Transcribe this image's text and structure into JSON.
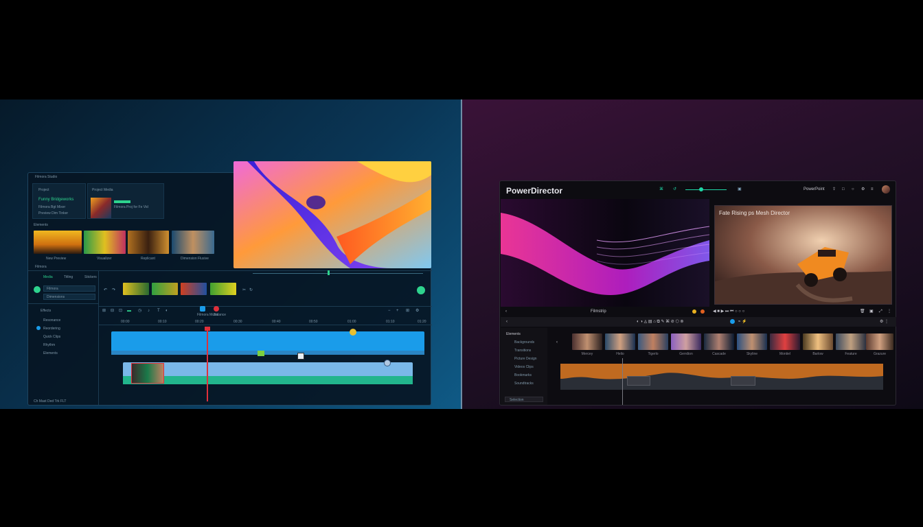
{
  "left_app": {
    "window_title": "Filmora Studio",
    "media_tabs": [
      "Project",
      "Project Media"
    ],
    "project_lines": [
      "Funny Bridgeworks",
      "Filmora Bgt Mixer",
      "Preview Dim Tinker"
    ],
    "thumb_caption": "Filmora Proj for Fe Vid",
    "section_label": "Elements",
    "thumb_labels": [
      "New Preview",
      "Visualizer",
      "Replicant",
      "Dimension Flusive"
    ],
    "panel_label": "Filmora",
    "mode_tabs": [
      "Media",
      "Titling",
      "Stickers"
    ],
    "props": [
      "Filmora",
      "Dimensions"
    ],
    "nav_items": [
      "Effects",
      "Resonance",
      "Reordering",
      "Quick Clips",
      "Rhythm",
      "Elements"
    ],
    "timecodes": [
      "00:00",
      "00:10",
      "00:20",
      "00:30",
      "00:40",
      "00:50",
      "01:00",
      "01:10",
      "01:20"
    ],
    "status": "Ch  Mast  Ded  Trk  FLT",
    "tool_labels": [
      "Filmora Music",
      "Balance"
    ]
  },
  "right_app": {
    "app_title": "PowerDirector",
    "header_right": "PowerPoint",
    "preview_caption": "Fate Rising ps Mesh Director",
    "strip_label": "Filmstrip",
    "side_label": "Elements",
    "side_items": [
      "Backgrounds",
      "Transitions",
      "Picture Design",
      "Videos Clips",
      "Bookmarks",
      "Soundtracks"
    ],
    "film_labels": [
      "Mercey",
      "Helio",
      "Tigerlo",
      "Gerrdion",
      "Cascade",
      "Skyline",
      "Montiel",
      "Barlow",
      "Feature",
      "Grazure"
    ],
    "bottom_field": "Selection"
  },
  "colors": {
    "accent_green": "#2ed38e",
    "track_blue": "#1a9cea",
    "track_teal": "#22b58c",
    "playhead": "#e0303b",
    "right_accent": "#1fd7a6"
  }
}
